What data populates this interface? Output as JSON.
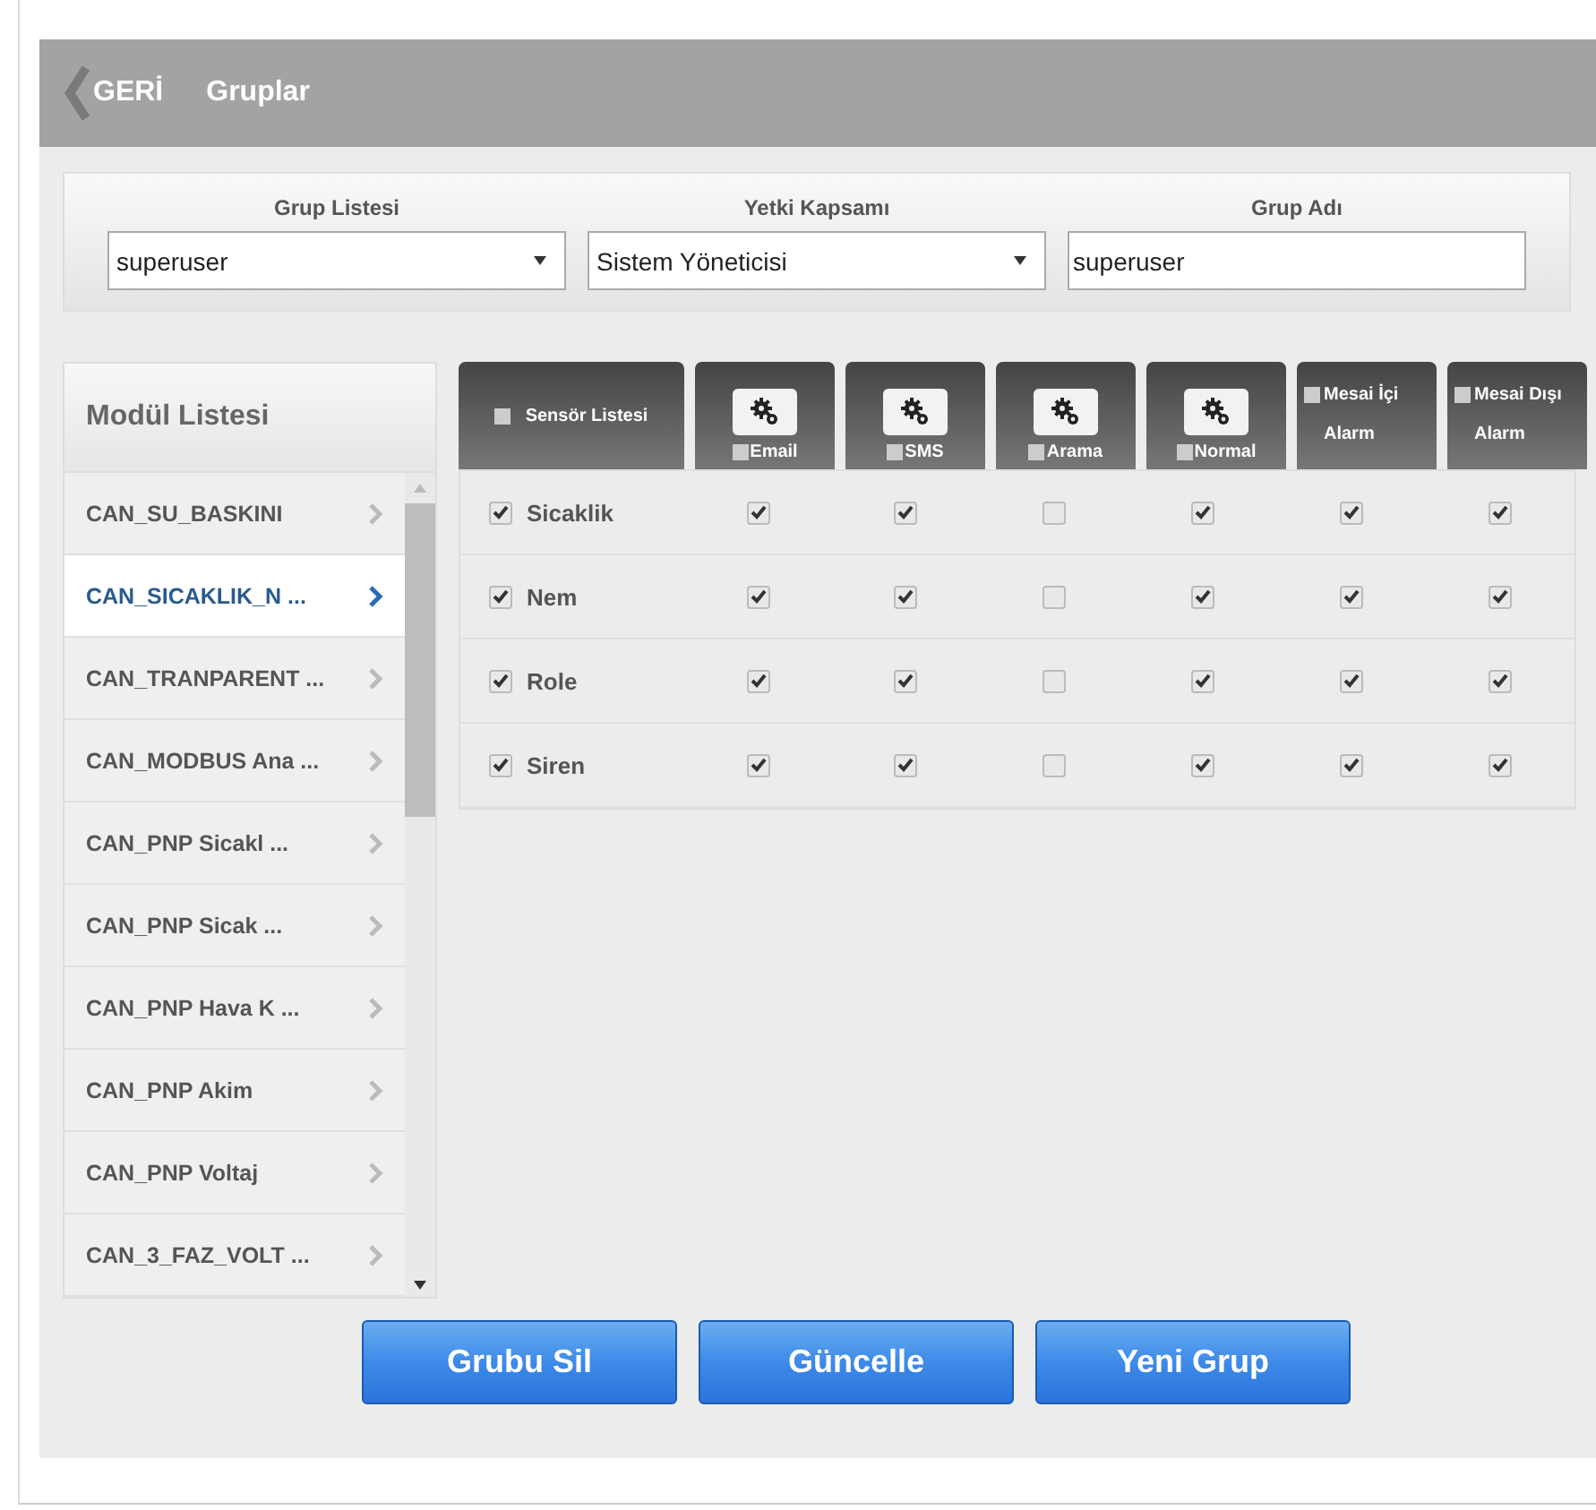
{
  "header": {
    "back_label": "GERİ",
    "title": "Gruplar"
  },
  "filters": [
    {
      "label": "Grup Listesi",
      "value": "superuser",
      "kind": "select"
    },
    {
      "label": "Yetki Kapsamı",
      "value": "Sistem Yöneticisi",
      "kind": "select"
    },
    {
      "label": "Grup Adı",
      "value": "superuser",
      "kind": "input"
    }
  ],
  "module_list": {
    "title": "Modül Listesi",
    "items": [
      {
        "label": "CAN_SU_BASKINI",
        "selected": false
      },
      {
        "label": "CAN_SICAKLIK_N ...",
        "selected": true
      },
      {
        "label": "CAN_TRANPARENT ...",
        "selected": false
      },
      {
        "label": "CAN_MODBUS Ana ...",
        "selected": false
      },
      {
        "label": "CAN_PNP Sicakl ...",
        "selected": false
      },
      {
        "label": "CAN_PNP Sicak ...",
        "selected": false
      },
      {
        "label": "CAN_PNP Hava K ...",
        "selected": false
      },
      {
        "label": "CAN_PNP Akim",
        "selected": false
      },
      {
        "label": "CAN_PNP Voltaj",
        "selected": false
      },
      {
        "label": "CAN_3_FAZ_VOLT ...",
        "selected": false
      }
    ]
  },
  "table": {
    "columns": [
      {
        "label": "Sensör Listesi",
        "kind": "sensor",
        "checked": false
      },
      {
        "label": "Email",
        "kind": "gear",
        "checked": false
      },
      {
        "label": "SMS",
        "kind": "gear",
        "checked": false
      },
      {
        "label": "Arama",
        "kind": "gear",
        "checked": false
      },
      {
        "label": "Normal",
        "kind": "gear",
        "checked": false
      },
      {
        "label": "Mesai İçi Alarm",
        "kind": "plain",
        "checked": false
      },
      {
        "label": "Mesai Dışı Alarm",
        "kind": "plain",
        "checked": false
      }
    ],
    "rows": [
      {
        "name": "Sicaklik",
        "checked": true,
        "values": [
          true,
          true,
          false,
          true,
          true,
          true
        ]
      },
      {
        "name": "Nem",
        "checked": true,
        "values": [
          true,
          true,
          false,
          true,
          true,
          true
        ]
      },
      {
        "name": "Role",
        "checked": true,
        "values": [
          true,
          true,
          false,
          true,
          true,
          true
        ]
      },
      {
        "name": "Siren",
        "checked": true,
        "values": [
          true,
          true,
          false,
          true,
          true,
          true
        ]
      }
    ]
  },
  "buttons": [
    "Grubu Sil",
    "Güncelle",
    "Yeni Grup"
  ]
}
